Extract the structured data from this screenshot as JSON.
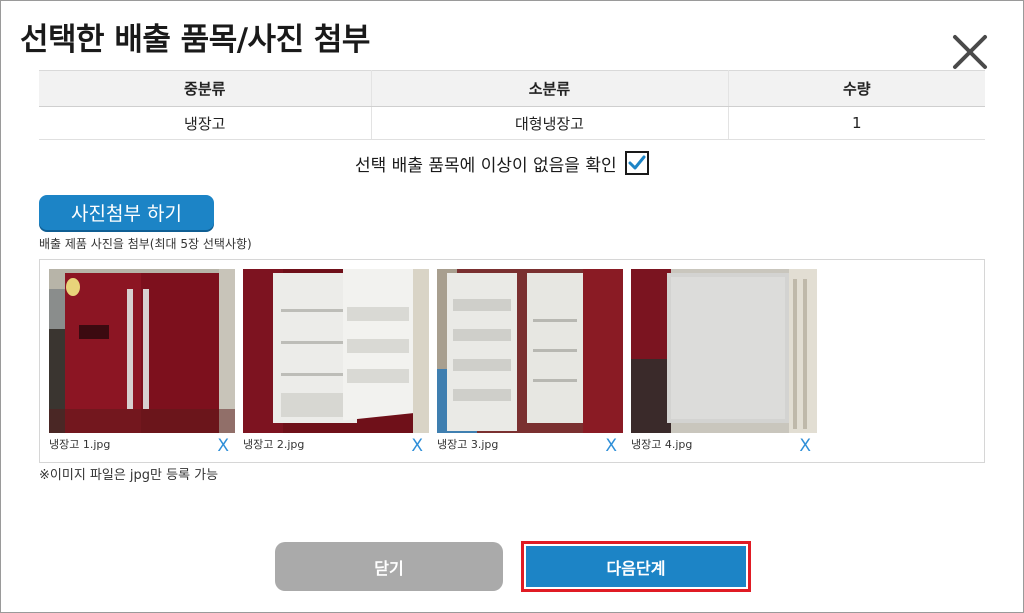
{
  "dialog": {
    "title": "선택한 배출 품목/사진 첨부",
    "close_icon": "close-icon"
  },
  "table": {
    "headers": [
      "중분류",
      "소분류",
      "수량"
    ],
    "rows": [
      [
        "냉장고",
        "대형냉장고",
        "1"
      ]
    ]
  },
  "confirm": {
    "label": "선택 배출 품목에 이상이 없음을 확인",
    "checked": true
  },
  "attach": {
    "button_label": "사진첨부 하기",
    "description": "배출 제품 사진을 첨부(최대 5장 선택사항)"
  },
  "photos": [
    {
      "filename": "냉장고 1.jpg",
      "delete_label": "X"
    },
    {
      "filename": "냉장고 2.jpg",
      "delete_label": "X"
    },
    {
      "filename": "냉장고 3.jpg",
      "delete_label": "X"
    },
    {
      "filename": "냉장고 4.jpg",
      "delete_label": "X"
    }
  ],
  "note": "※이미지 파일은 jpg만 등록 가능",
  "footer": {
    "close_label": "닫기",
    "next_label": "다음단계"
  },
  "colors": {
    "accent": "#1c84c6",
    "highlight_border": "#e01b24",
    "close_button": "#aaaaaa"
  }
}
